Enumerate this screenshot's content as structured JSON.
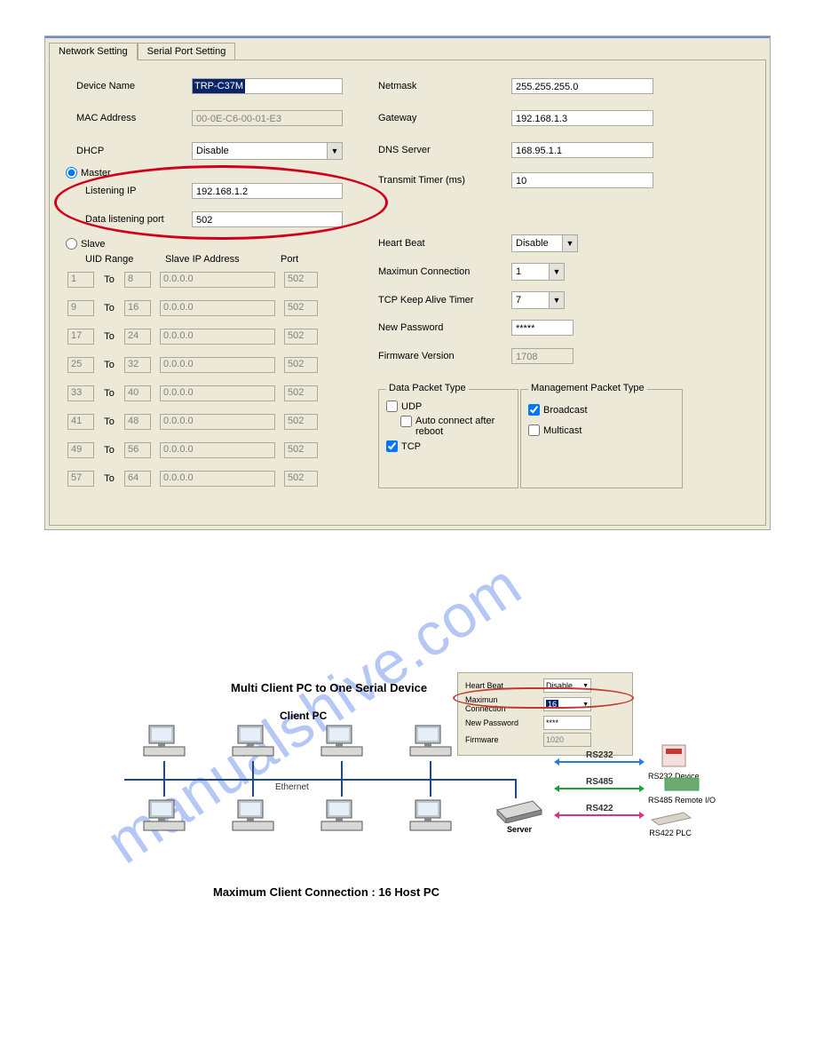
{
  "tabs": {
    "network": "Network Setting",
    "serial": "Serial Port Setting"
  },
  "left": {
    "deviceName_label": "Device Name",
    "deviceName_value": "TRP-C37M",
    "mac_label": "MAC Address",
    "mac_value": "00-0E-C6-00-01-E3",
    "dhcp_label": "DHCP",
    "dhcp_value": "Disable",
    "master_label": "Master",
    "listeningIp_label": "Listening IP",
    "listeningIp_value": "192.168.1.2",
    "dataPort_label": "Data listening port",
    "dataPort_value": "502",
    "slave_label": "Slave",
    "uidRange_label": "UID Range",
    "slaveIp_label": "Slave IP Address",
    "port_label": "Port",
    "to_label": "To",
    "rows": [
      {
        "from": "1",
        "to": "8",
        "ip": "0.0.0.0",
        "port": "502"
      },
      {
        "from": "9",
        "to": "16",
        "ip": "0.0.0.0",
        "port": "502"
      },
      {
        "from": "17",
        "to": "24",
        "ip": "0.0.0.0",
        "port": "502"
      },
      {
        "from": "25",
        "to": "32",
        "ip": "0.0.0.0",
        "port": "502"
      },
      {
        "from": "33",
        "to": "40",
        "ip": "0.0.0.0",
        "port": "502"
      },
      {
        "from": "41",
        "to": "48",
        "ip": "0.0.0.0",
        "port": "502"
      },
      {
        "from": "49",
        "to": "56",
        "ip": "0.0.0.0",
        "port": "502"
      },
      {
        "from": "57",
        "to": "64",
        "ip": "0.0.0.0",
        "port": "502"
      }
    ]
  },
  "right": {
    "netmask_label": "Netmask",
    "netmask_value": "255.255.255.0",
    "gateway_label": "Gateway",
    "gateway_value": "192.168.1.3",
    "dns_label": "DNS Server",
    "dns_value": "168.95.1.1",
    "transmit_label": "Transmit Timer (ms)",
    "transmit_value": "10",
    "heartbeat_label": "Heart Beat",
    "heartbeat_value": "Disable",
    "maxconn_label": "Maximun Connection",
    "maxconn_value": "1",
    "keepalive_label": "TCP Keep Alive Timer",
    "keepalive_value": "7",
    "newpw_label": "New Password",
    "newpw_value": "*****",
    "fw_label": "Firmware Version",
    "fw_value": "1708"
  },
  "dataPacket": {
    "legend": "Data Packet Type",
    "udp": "UDP",
    "autoconnect": "Auto connect after reboot",
    "tcp": "TCP"
  },
  "mgmtPacket": {
    "legend": "Management Packet Type",
    "broadcast": "Broadcast",
    "multicast": "Multicast"
  },
  "diagram": {
    "title": "Multi Client PC to One Serial Device",
    "clientpc": "Client PC",
    "ethernet": "Ethernet",
    "server": "Server",
    "rs232": "RS232",
    "rs232device": "RS232 Device",
    "rs485": "RS485",
    "rs485remote": "RS485 Remote I/O",
    "rs422": "RS422",
    "rs422plc": "RS422 PLC",
    "mini": {
      "heartbeat_label": "Heart Beat",
      "heartbeat_value": "Disable",
      "maxconn_label": "Maximun Connection",
      "maxconn_value": "16",
      "newpw_label": "New Password",
      "newpw_value": "****",
      "fw_label": "Firmware",
      "fw_value": "1020"
    },
    "caption": "Maximum Client Connection : 16 Host PC"
  },
  "watermark": "manualshive.com"
}
